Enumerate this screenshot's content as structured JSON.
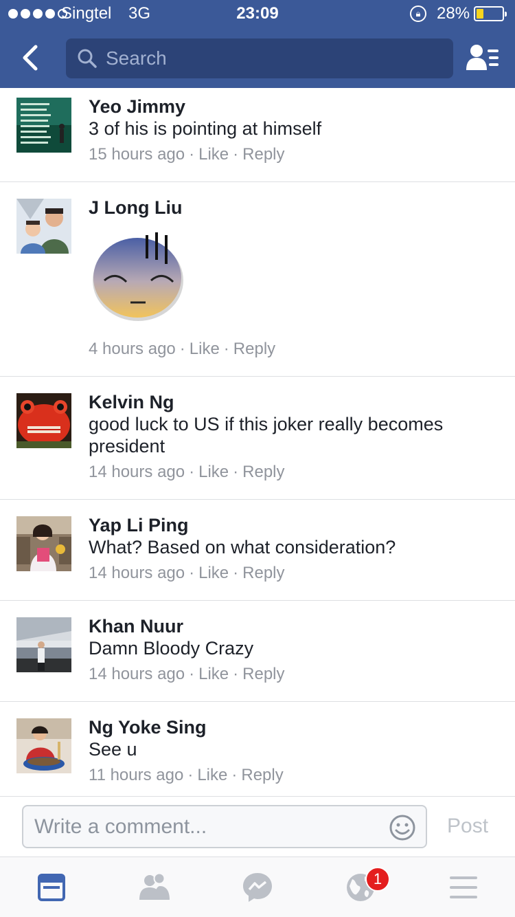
{
  "status_bar": {
    "carrier": "Singtel",
    "network": "3G",
    "time": "23:09",
    "battery_percent": "28%",
    "battery_level": 0.28,
    "signal_bars_filled": 4,
    "signal_bars_total": 5
  },
  "header": {
    "search_placeholder": "Search",
    "back_icon": "chevron-left-icon",
    "right_icon": "friends-list-icon"
  },
  "colors": {
    "brand": "#3b5998",
    "search_bg": "#2c4377",
    "link_meta": "#90949c",
    "badge": "#e41e1e",
    "active_tab": "#4267b2"
  },
  "comments": [
    {
      "author": "Yeo Jimmy",
      "text": "3 of his is pointing at himself",
      "time": "15 hours ago",
      "like": "Like",
      "reply": "Reply",
      "sep": "·"
    },
    {
      "author": "J Long Liu",
      "text": "",
      "sticker": "sleepy-sweat-face-sticker",
      "time": "4 hours ago",
      "like": "Like",
      "reply": "Reply",
      "sep": "·"
    },
    {
      "author": "Kelvin Ng",
      "text": "good luck to US if this joker really becomes president",
      "time": "14 hours ago",
      "like": "Like",
      "reply": "Reply",
      "sep": "·"
    },
    {
      "author": "Yap Li Ping",
      "text": "What? Based on what consideration?",
      "time": "14 hours ago",
      "like": "Like",
      "reply": "Reply",
      "sep": "·"
    },
    {
      "author": "Khan Nuur",
      "text": "Damn Bloody Crazy",
      "time": "14 hours ago",
      "like": "Like",
      "reply": "Reply",
      "sep": "·"
    },
    {
      "author": "Ng Yoke Sing",
      "text": "See u",
      "time": "11 hours ago",
      "like": "Like",
      "reply": "Reply",
      "sep": "·"
    }
  ],
  "composer": {
    "placeholder": "Write a comment...",
    "post_label": "Post",
    "emoji_icon": "smiley-icon"
  },
  "tabbar": {
    "tabs": [
      {
        "icon": "news-feed-icon",
        "active": true
      },
      {
        "icon": "friend-requests-icon",
        "active": false
      },
      {
        "icon": "messenger-icon",
        "active": false
      },
      {
        "icon": "notifications-globe-icon",
        "active": false,
        "badge": "1"
      },
      {
        "icon": "menu-icon",
        "active": false
      }
    ]
  }
}
